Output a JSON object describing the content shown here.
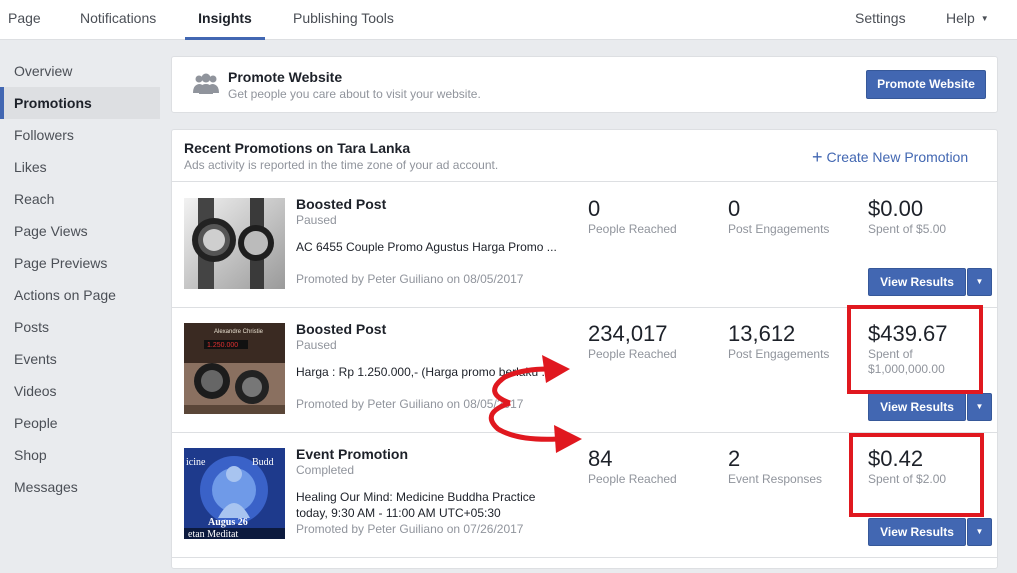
{
  "nav": {
    "tabs": [
      "Page",
      "Notifications",
      "Insights",
      "Publishing Tools"
    ],
    "active": "Insights",
    "settings": "Settings",
    "help": "Help"
  },
  "sidebar": {
    "items": [
      "Overview",
      "Promotions",
      "Followers",
      "Likes",
      "Reach",
      "Page Views",
      "Page Previews",
      "Actions on Page",
      "Posts",
      "Events",
      "Videos",
      "People",
      "Shop",
      "Messages"
    ],
    "active": "Promotions"
  },
  "promote": {
    "title": "Promote Website",
    "subtitle": "Get people you care about to visit your website.",
    "button": "Promote Website"
  },
  "recent": {
    "title": "Recent Promotions on Tara Lanka",
    "subtitle": "Ads activity is reported in the time zone of your ad account.",
    "create_label": "Create New Promotion",
    "view_results": "View Results",
    "promotions": [
      {
        "type": "Boosted Post",
        "status": "Paused",
        "description": "AC 6455 Couple Promo Agustus Harga Promo ...",
        "promoted_by": "Promoted by Peter Guiliano on 08/05/2017",
        "reached": "0",
        "reached_label": "People Reached",
        "engage": "0",
        "engage_label": "Post Engagements",
        "spent": "$0.00",
        "spent_label": "Spent of $5.00"
      },
      {
        "type": "Boosted Post",
        "status": "Paused",
        "description": "Harga : Rp 1.250.000,- (Harga promo berlaku ...",
        "promoted_by": "Promoted by Peter Guiliano on 08/05/2017",
        "reached": "234,017",
        "reached_label": "People Reached",
        "engage": "13,612",
        "engage_label": "Post Engagements",
        "spent": "$439.67",
        "spent_label": "Spent of $1,000,000.00"
      },
      {
        "type": "Event Promotion",
        "status": "Completed",
        "description": "Healing Our Mind: Medicine Buddha Practice today, 9:30 AM - 11:00 AM UTC+05:30",
        "promoted_by": "Promoted by Peter Guiliano on 07/26/2017",
        "reached": "84",
        "reached_label": "People Reached",
        "engage": "2",
        "engage_label": "Event Responses",
        "spent": "$0.42",
        "spent_label": "Spent of $2.00"
      }
    ]
  },
  "thumb_text": {
    "event_left": "icine",
    "event_right": "Budd",
    "event_date": "Augus 26",
    "event_bottom": "etan Meditat",
    "watch_price": "1.250.000"
  },
  "colors": {
    "brand": "#4267b2",
    "annotation": "#e0181f"
  }
}
